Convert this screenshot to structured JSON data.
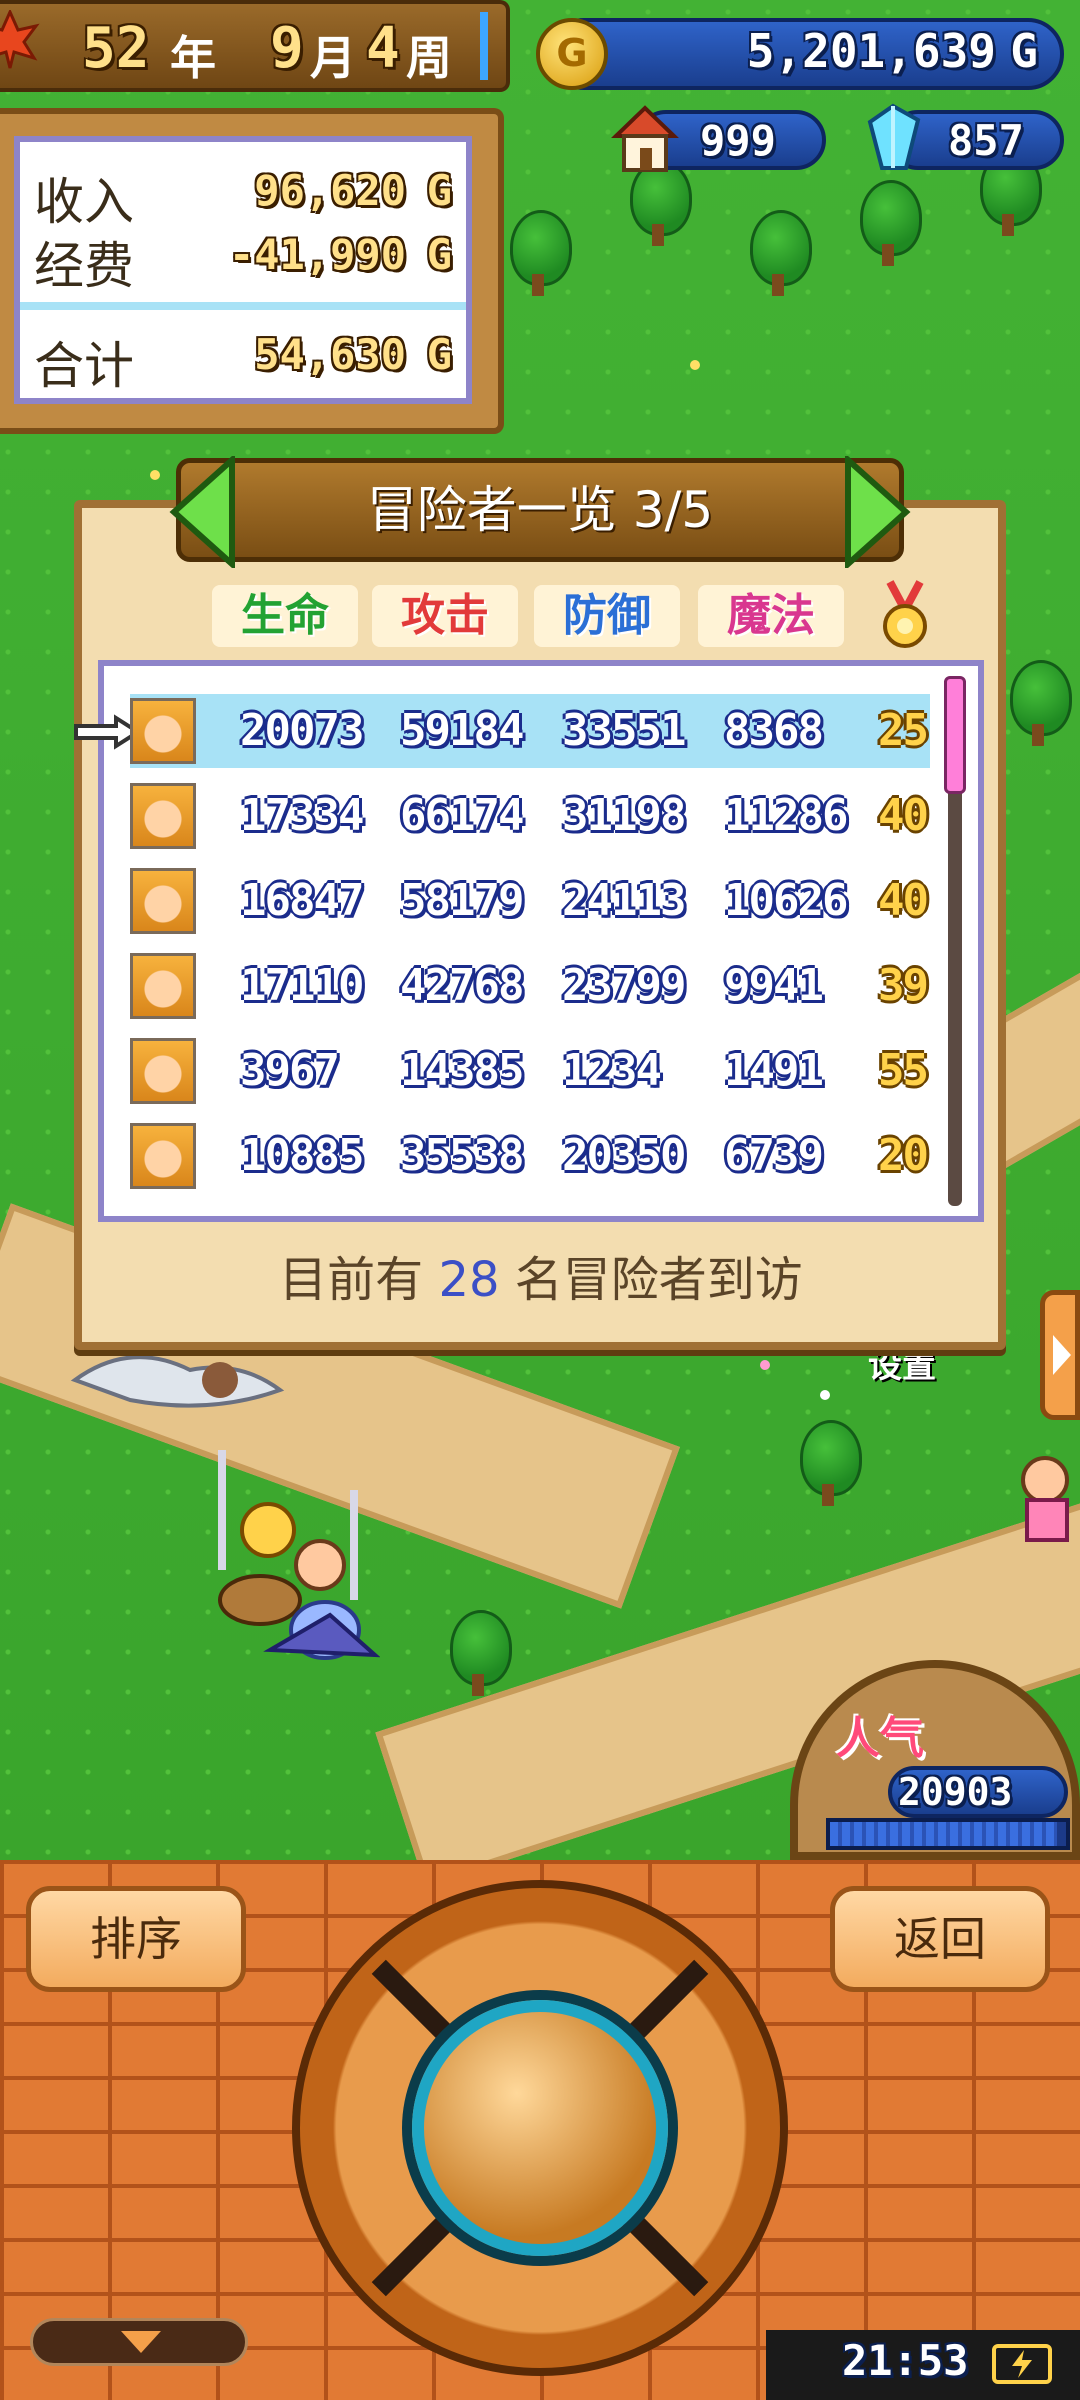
{
  "hud": {
    "year": "52",
    "year_unit": "年",
    "month": "9",
    "month_unit": "月",
    "week": "4",
    "week_unit": "周",
    "gold": "5,201,639",
    "gold_unit": "G",
    "houses": "999",
    "crystals": "857"
  },
  "finance": {
    "income_label": "收入",
    "income_value": "96,620",
    "expense_label": "经费",
    "expense_value": "-41,990",
    "total_label": "合计",
    "total_value": "54,630",
    "unit": "G"
  },
  "panel": {
    "title": "冒险者一览 3/5",
    "categories": [
      "生命",
      "攻击",
      "防御",
      "魔法"
    ],
    "category_colors": [
      "#23a233",
      "#e23a3a",
      "#2b6fd6",
      "#d9378f"
    ],
    "rows": [
      {
        "hp": "20073",
        "atk": "59184",
        "def": "33551",
        "mag": "8368",
        "lvl": "25",
        "selected": true
      },
      {
        "hp": "17334",
        "atk": "66174",
        "def": "31198",
        "mag": "11286",
        "lvl": "40",
        "selected": false
      },
      {
        "hp": "16847",
        "atk": "58179",
        "def": "24113",
        "mag": "10626",
        "lvl": "40",
        "selected": false
      },
      {
        "hp": "17110",
        "atk": "42768",
        "def": "23799",
        "mag": "9941",
        "lvl": "39",
        "selected": false
      },
      {
        "hp": "3967",
        "atk": "14385",
        "def": "1234",
        "mag": "1491",
        "lvl": "55",
        "selected": false
      },
      {
        "hp": "10885",
        "atk": "35538",
        "def": "20350",
        "mag": "6739",
        "lvl": "20",
        "selected": false
      }
    ],
    "footer_prefix": "目前有",
    "footer_count": "28",
    "footer_suffix": "名冒险者到访"
  },
  "world": {
    "popularity_label": "人气",
    "popularity_value": "20903",
    "sign_text": "设置"
  },
  "controls": {
    "sort_label": "排序",
    "back_label": "返回"
  },
  "status": {
    "time": "21:53"
  }
}
